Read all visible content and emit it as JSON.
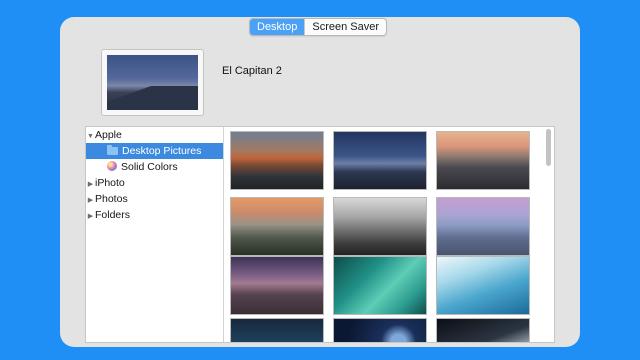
{
  "tabs": [
    {
      "label": "Desktop",
      "active": true
    },
    {
      "label": "Screen Saver",
      "active": false
    }
  ],
  "current": {
    "name": "El Capitan 2"
  },
  "sidebar": {
    "items": [
      {
        "label": "Apple",
        "level": 0,
        "expanded": true,
        "icon": "disclosure-open-icon"
      },
      {
        "label": "Desktop Pictures",
        "level": 1,
        "selected": true,
        "icon": "folder-icon"
      },
      {
        "label": "Solid Colors",
        "level": 1,
        "icon": "color-wheel-icon"
      },
      {
        "label": "iPhoto",
        "level": 0,
        "expanded": false,
        "icon": "disclosure-closed-icon"
      },
      {
        "label": "Photos",
        "level": 0,
        "expanded": false,
        "icon": "disclosure-closed-icon"
      },
      {
        "label": "Folders",
        "level": 0,
        "expanded": false,
        "icon": "disclosure-closed-icon"
      }
    ]
  },
  "colors": {
    "background": "#1f8ff5",
    "accent": "#4aa1f5",
    "selection": "#3b8ae0"
  }
}
